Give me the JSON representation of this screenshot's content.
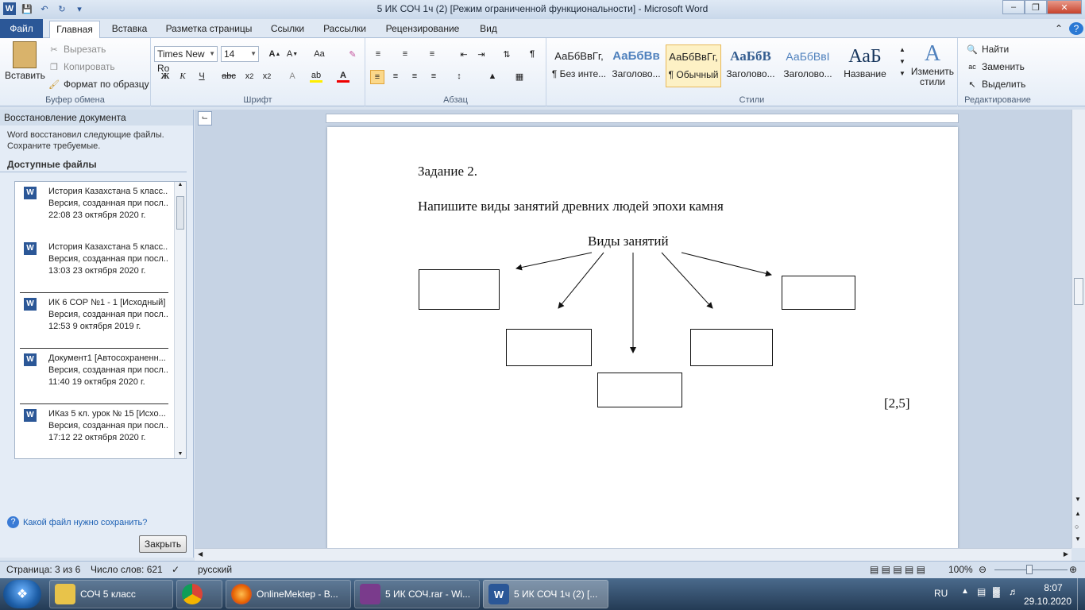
{
  "window": {
    "title": "5 ИК СОЧ 1ч (2) [Режим ограниченной функциональности]  -  Microsoft Word"
  },
  "tabs": [
    {
      "label": "Файл"
    },
    {
      "label": "Главная"
    },
    {
      "label": "Вставка"
    },
    {
      "label": "Разметка страницы"
    },
    {
      "label": "Ссылки"
    },
    {
      "label": "Рассылки"
    },
    {
      "label": "Рецензирование"
    },
    {
      "label": "Вид"
    }
  ],
  "ribbon": {
    "clipboard": {
      "paste": "Вставить",
      "cut": "Вырезать",
      "copy": "Копировать",
      "format_painter": "Формат по образцу",
      "label": "Буфер обмена"
    },
    "font": {
      "name": "Times New Ro",
      "size": "14",
      "label": "Шрифт"
    },
    "paragraph": {
      "label": "Абзац"
    },
    "styles": {
      "label": "Стили",
      "items": [
        {
          "sample": "АаБбВвГг,",
          "name": "¶ Без инте..."
        },
        {
          "sample": "АаБбВв",
          "name": "Заголово..."
        },
        {
          "sample": "АаБбВвГг,",
          "name": "¶ Обычный"
        },
        {
          "sample": "АаБбВ",
          "name": "Заголово..."
        },
        {
          "sample": "АаБбВвI",
          "name": "Заголово..."
        },
        {
          "sample": "АаБ",
          "name": "Название"
        }
      ],
      "change_styles": "Изменить стили"
    },
    "editing": {
      "label": "Редактирование",
      "find": "Найти",
      "replace": "Заменить",
      "select": "Выделить"
    }
  },
  "recovery": {
    "title": "Восстановление документа",
    "description": "Word восстановил следующие файлы. Сохраните требуемые.",
    "available_label": "Доступные файлы",
    "files": [
      {
        "name": "История Казахстана 5 класс...",
        "version": "Версия, созданная при посл...",
        "time": "22:08 23 октября 2020 г."
      },
      {
        "name": "История Казахстана 5 класс...",
        "version": "Версия, созданная при посл...",
        "time": "13:03 23 октября 2020 г."
      },
      {
        "name": "ИК 6 СОР №1 - 1  [Исходный]",
        "version": "Версия, созданная при посл...",
        "time": "12:53 9 октября 2019 г."
      },
      {
        "name": "Документ1  [Автосохраненн...",
        "version": "Версия, созданная при посл...",
        "time": "11:40 19 октября 2020 г."
      },
      {
        "name": "ИКаз 5 кл. урок № 15  [Исхо...",
        "version": "Версия, созданная при посл...",
        "time": "17:12 22 октября 2020 г."
      }
    ],
    "help_link": "Какой файл нужно сохранить?",
    "close_button": "Закрыть"
  },
  "document": {
    "task_title": "Задание  2.",
    "instruction": "Напишите  виды занятий  древних  людей  эпохи камня",
    "diagram_title": "Виды занятий",
    "score": "[2,5]"
  },
  "status": {
    "page": "Страница: 3 из 6",
    "words": "Число слов: 621",
    "language": "русский",
    "zoom": "100%"
  },
  "taskbar": {
    "items": [
      {
        "label": "СОЧ 5 класс"
      },
      {
        "label": ""
      },
      {
        "label": "OnlineMektep - В..."
      },
      {
        "label": "5 ИК СОЧ.rar - Wi..."
      },
      {
        "label": "5 ИК СОЧ 1ч (2) [..."
      }
    ],
    "lang": "RU",
    "time": "8:07",
    "date": "29.10.2020"
  }
}
